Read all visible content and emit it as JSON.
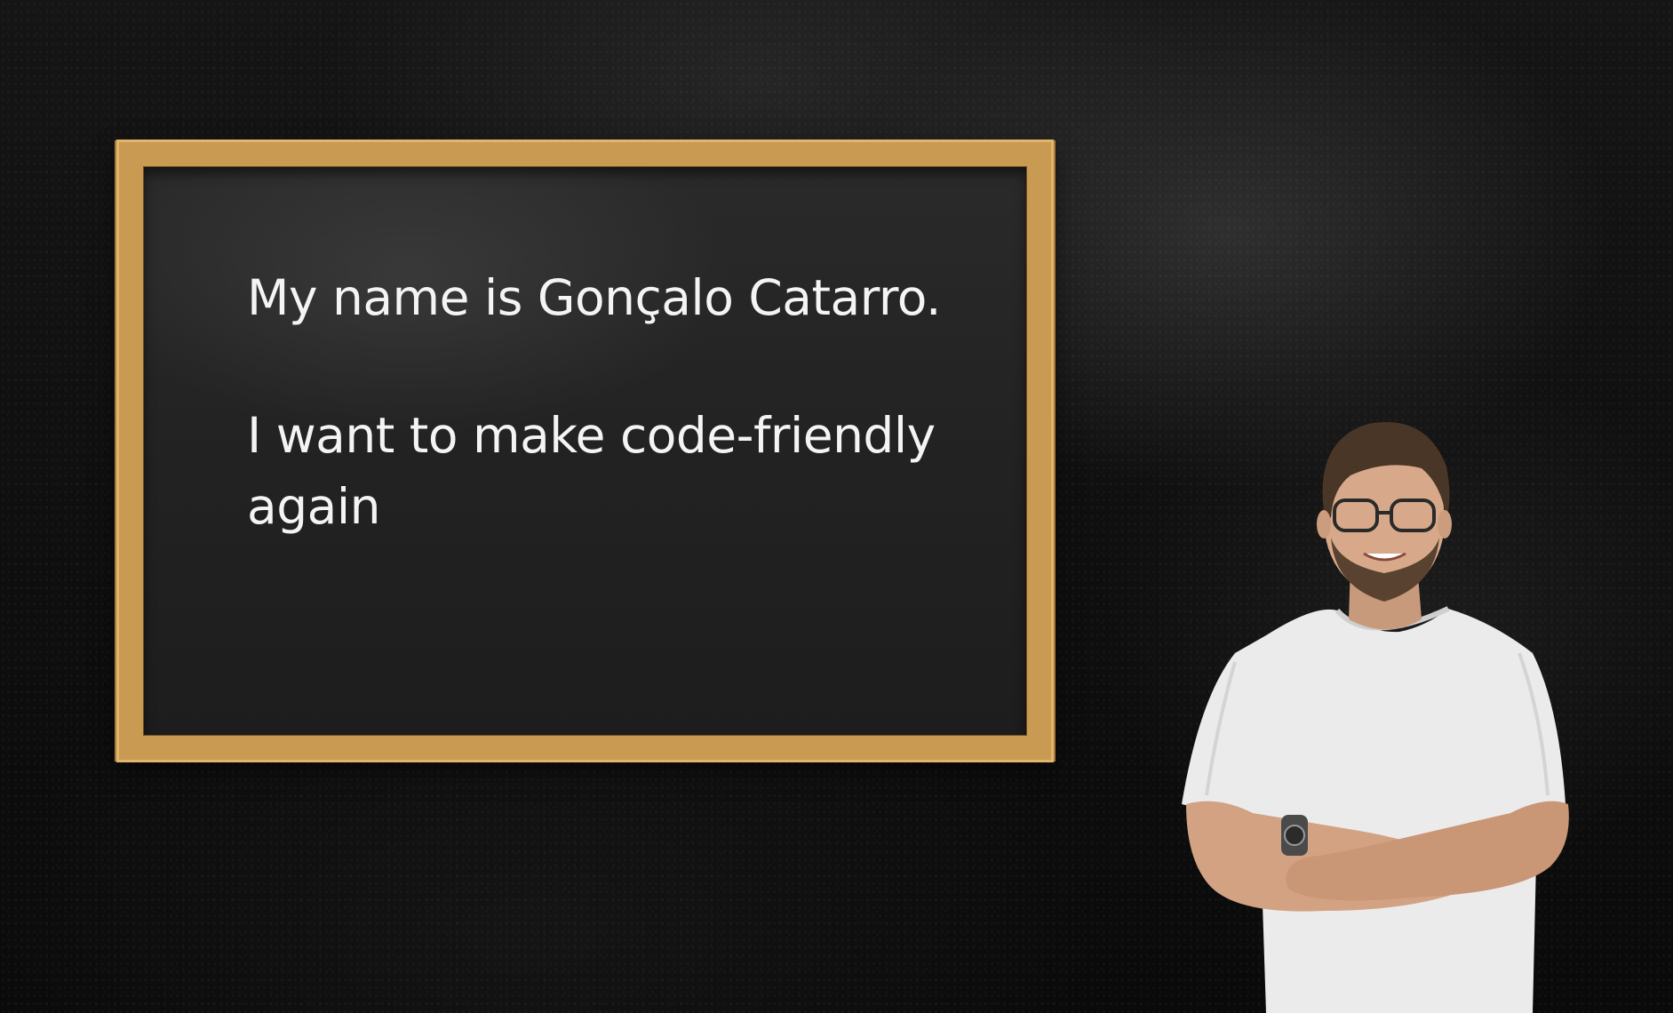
{
  "chalkboard": {
    "line1": "My name is Gonçalo Catarro.",
    "line2": "I want to make code-friendly",
    "line3": "again"
  },
  "person": {
    "icon": "person-arms-crossed-photo"
  },
  "colors": {
    "background": "#0d0d0d",
    "board_surface": "#232323",
    "frame_wood": "#c99a52",
    "text": "#f4f4f4",
    "shirt": "#ececec"
  }
}
